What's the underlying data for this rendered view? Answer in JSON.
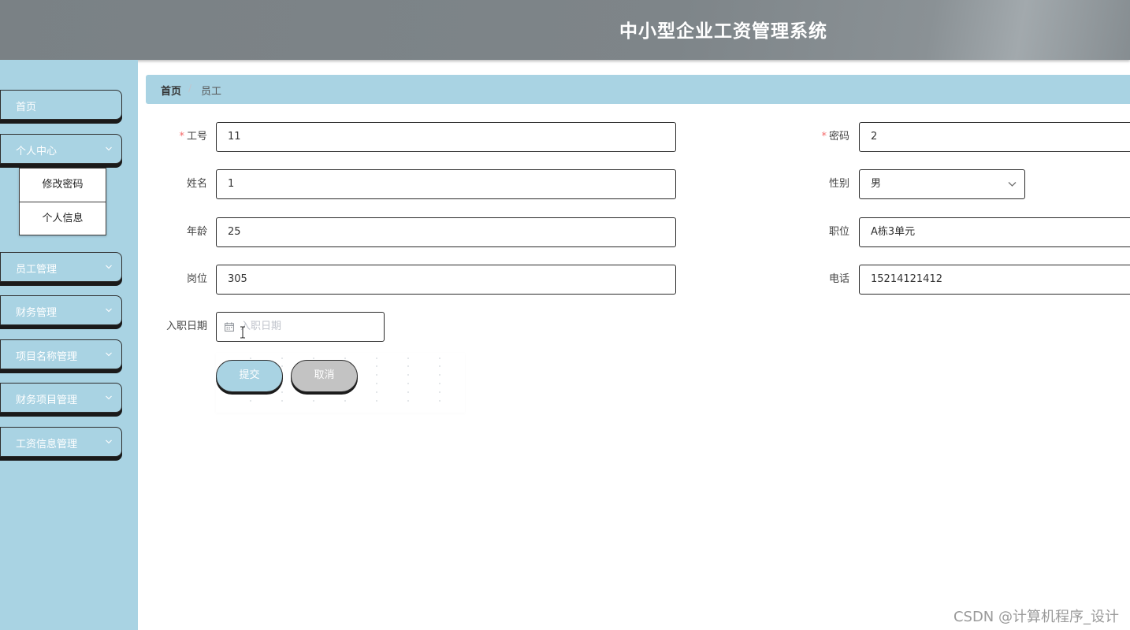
{
  "header": {
    "title": "中小型企业工资管理系统"
  },
  "sidebar": {
    "items": [
      {
        "label": "首页",
        "has_chevron": false
      },
      {
        "label": "个人中心",
        "has_chevron": true,
        "expanded": true
      },
      {
        "label": "员工管理",
        "has_chevron": true
      },
      {
        "label": "财务管理",
        "has_chevron": true
      },
      {
        "label": "项目名称管理",
        "has_chevron": true
      },
      {
        "label": "财务项目管理",
        "has_chevron": true
      },
      {
        "label": "工资信息管理",
        "has_chevron": true
      }
    ],
    "submenu": [
      {
        "label": "修改密码"
      },
      {
        "label": "个人信息"
      }
    ]
  },
  "breadcrumb": {
    "home": "首页",
    "separator": "/",
    "current": "员工"
  },
  "form": {
    "employee_id": {
      "label": "工号",
      "value": "11",
      "required": true
    },
    "password": {
      "label": "密码",
      "value": "2",
      "required": true
    },
    "name": {
      "label": "姓名",
      "value": "1"
    },
    "gender": {
      "label": "性别",
      "value": "男"
    },
    "age": {
      "label": "年龄",
      "value": "25"
    },
    "position": {
      "label": "职位",
      "value": "A栋3单元"
    },
    "post": {
      "label": "岗位",
      "value": "305"
    },
    "phone": {
      "label": "电话",
      "value": "15214121412"
    },
    "hire_date": {
      "label": "入职日期",
      "placeholder": "入职日期",
      "value": ""
    },
    "submit_label": "提交",
    "cancel_label": "取消"
  },
  "watermark": "CSDN @计算机程序_设计",
  "colors": {
    "sidebar_bg": "#a9d3e3",
    "header_bg": "#7e8589",
    "required": "#f56c6c",
    "cancel_bg": "#c3c3c3"
  }
}
